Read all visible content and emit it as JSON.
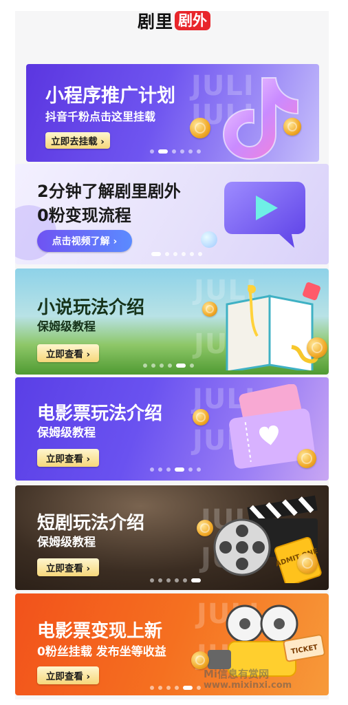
{
  "header": {
    "logo_main": "剧里",
    "logo_badge": "剧外"
  },
  "banners": [
    {
      "title": "小程序推广计划",
      "subtitle": "抖音千粉点击这里挂载",
      "cta": "立即去挂载 ›",
      "watermark": "JULI",
      "dots_active": 1,
      "dots_total": 6
    },
    {
      "title": "2分钟了解剧里剧外",
      "subtitle": "0粉变现流程",
      "cta": "点击视频了解 ›",
      "dots_active": 0,
      "dots_total": 6
    },
    {
      "title": "小说玩法介绍",
      "subtitle": "保姆级教程",
      "cta": "立即查看 ›",
      "watermark": "JULI",
      "dots_active": 4,
      "dots_total": 6
    },
    {
      "title": "电影票玩法介绍",
      "subtitle": "保姆级教程",
      "cta": "立即查看 ›",
      "watermark": "JULI",
      "dots_active": 3,
      "dots_total": 6
    },
    {
      "title": "短剧玩法介绍",
      "subtitle": "保姆级教程",
      "cta": "立即查看 ›",
      "watermark": "JULI",
      "dots_active": 5,
      "dots_total": 6
    },
    {
      "title": "电影票变现上新",
      "subtitle": "0粉丝挂载 发布坐等收益",
      "cta": "立即查看 ›",
      "watermark": "JULI",
      "dots_active": 4,
      "dots_total": 6
    }
  ],
  "decor": {
    "ticket_label": "TICKET",
    "admit_label": "ADMIT ONE"
  },
  "site_watermark": {
    "line1": "Mi信息有赏网",
    "line2": "www.mixinxi.com"
  }
}
